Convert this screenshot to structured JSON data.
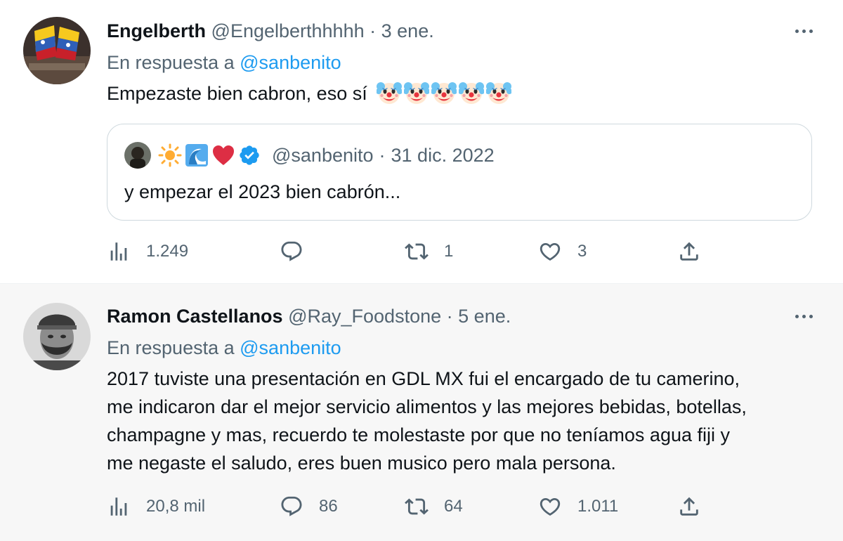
{
  "tweets": [
    {
      "author": {
        "display_name": "Engelberth",
        "handle": "@Engelberthhhhh",
        "avatar": "avatar-venezuela-flag"
      },
      "separator": "·",
      "date": "3 ene.",
      "more_icon": "more-horizontal-icon",
      "reply_to_label": "En respuesta a",
      "reply_to_handle": "@sanbenito",
      "text": "Empezaste bien cabron, eso sí",
      "emojis": [
        "clown-emoji",
        "clown-emoji",
        "clown-emoji",
        "clown-emoji",
        "clown-emoji"
      ],
      "quote": {
        "emojis": [
          "sun-emoji",
          "wave-emoji",
          "red-heart-emoji"
        ],
        "verified_icon": "verified-badge-icon",
        "handle": "@sanbenito",
        "separator": "·",
        "date": "31 dic. 2022",
        "text": "y empezar el 2023 bien cabrón..."
      },
      "stats": {
        "views": "1.249",
        "replies": "",
        "retweets": "1",
        "likes": "3"
      }
    },
    {
      "author": {
        "display_name": "Ramon Castellanos",
        "handle": "@Ray_Foodstone",
        "avatar": "avatar-man-with-cap"
      },
      "separator": "·",
      "date": "5 ene.",
      "more_icon": "more-horizontal-icon",
      "reply_to_label": "En respuesta a",
      "reply_to_handle": "@sanbenito",
      "text_lines": [
        "2017 tuviste una presentación en GDL MX fui el encargado de tu camerino,",
        "me indicaron dar el mejor servicio alimentos y las mejores bebidas, botellas,",
        "champagne y mas, recuerdo te molestaste por que no teníamos agua fiji y",
        "me negaste el saludo, eres buen musico pero mala persona."
      ],
      "stats": {
        "views": "20,8 mil",
        "replies": "86",
        "retweets": "64",
        "likes": "1.011"
      }
    }
  ],
  "icons": {
    "views": "analytics-icon",
    "reply": "reply-icon",
    "retweet": "retweet-icon",
    "like": "like-icon",
    "share": "share-icon"
  },
  "colors": {
    "link": "#1d9bf0",
    "secondary_text": "#536471",
    "primary_text": "#0f1419",
    "border": "#cfd9de",
    "verified": "#1d9bf0"
  }
}
